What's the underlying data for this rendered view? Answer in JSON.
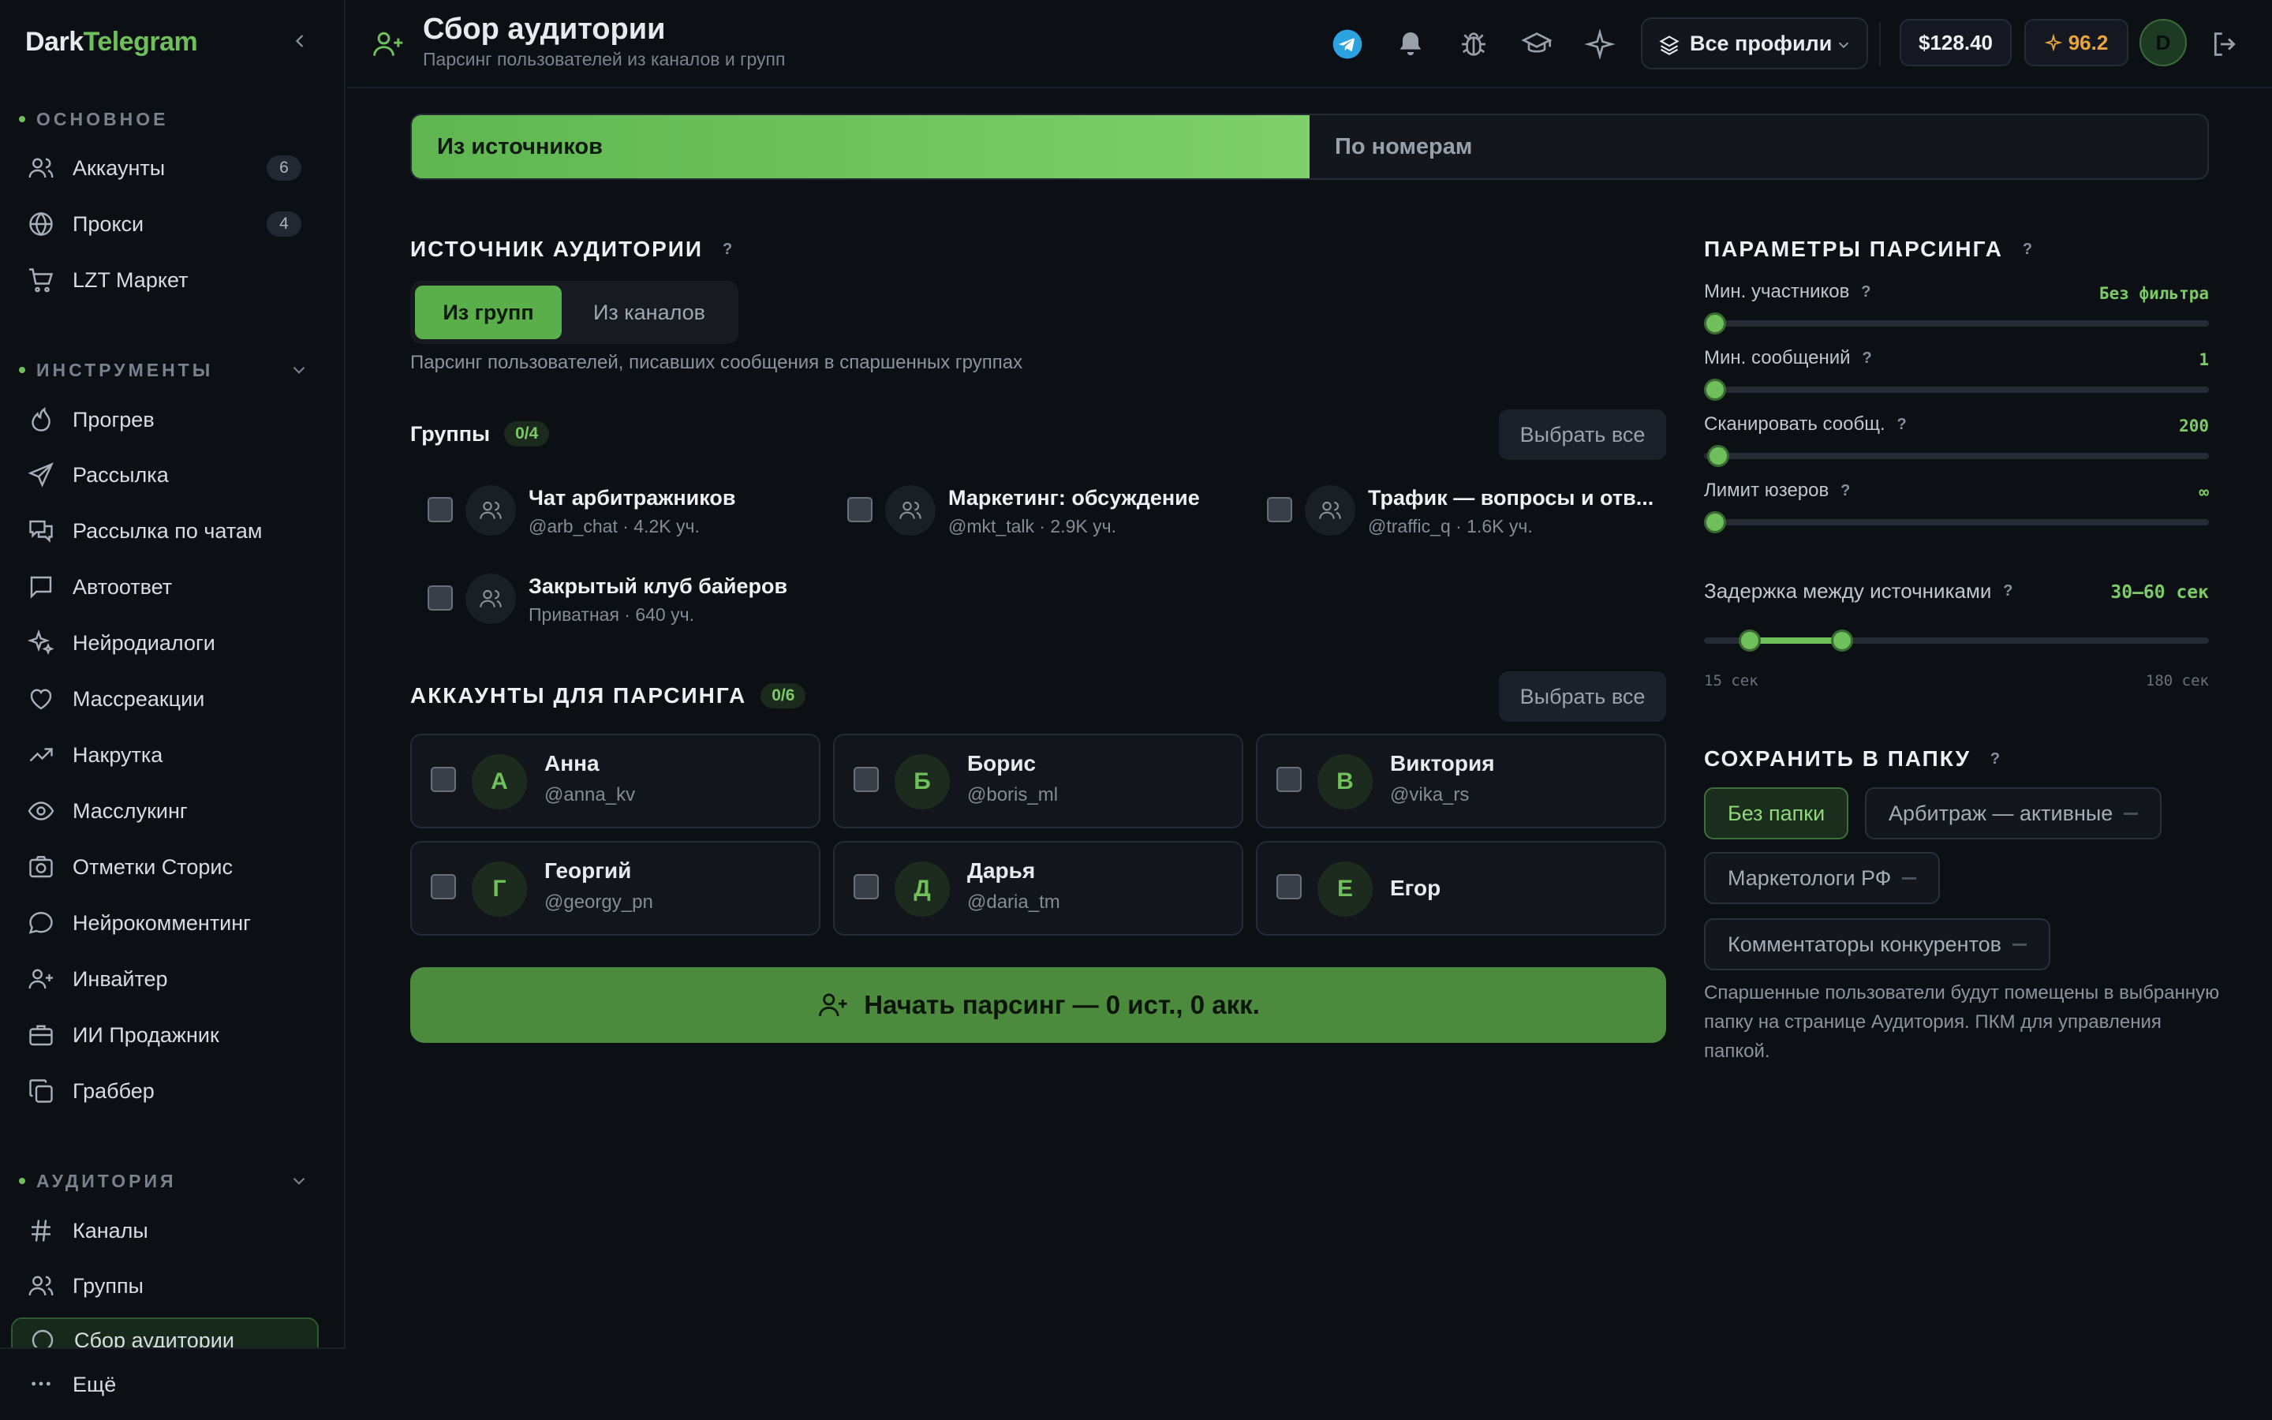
{
  "app": {
    "logo_dark": "Dark",
    "logo_green": "Telegram"
  },
  "sidebar": {
    "sections": {
      "main": "ОСНОВНОЕ",
      "tools": "ИНСТРУМЕНТЫ",
      "audience": "АУДИТОРИЯ"
    },
    "main_items": [
      {
        "label": "Аккаунты",
        "count": "6",
        "icon": "users-icon"
      },
      {
        "label": "Прокси",
        "count": "4",
        "icon": "globe-icon"
      },
      {
        "label": "LZT Маркет",
        "icon": "cart-icon"
      }
    ],
    "tool_items": [
      {
        "label": "Прогрев",
        "icon": "flame-icon"
      },
      {
        "label": "Рассылка",
        "icon": "send-icon"
      },
      {
        "label": "Рассылка по чатам",
        "icon": "chats-icon"
      },
      {
        "label": "Автоответ",
        "icon": "message-icon"
      },
      {
        "label": "Нейродиалоги",
        "icon": "sparkles-icon"
      },
      {
        "label": "Массреакции",
        "icon": "heart-icon"
      },
      {
        "label": "Накрутка",
        "icon": "trend-icon"
      },
      {
        "label": "Масслукинг",
        "icon": "eye-icon"
      },
      {
        "label": "Отметки Сторис",
        "icon": "camera-icon"
      },
      {
        "label": "Нейрокомментинг",
        "icon": "comment-icon"
      },
      {
        "label": "Инвайтер",
        "icon": "user-plus-icon"
      },
      {
        "label": "ИИ Продажник",
        "icon": "briefcase-icon"
      },
      {
        "label": "Граббер",
        "icon": "copy-icon"
      }
    ],
    "audience_items": [
      {
        "label": "Каналы",
        "icon": "hash-icon"
      },
      {
        "label": "Группы",
        "icon": "users-icon"
      },
      {
        "label": "Сбор аудитории",
        "icon": "circle-icon"
      }
    ],
    "more": "Ещё"
  },
  "header": {
    "title": "Сбор аудитории",
    "subtitle": "Парсинг пользователей из каналов и групп",
    "profiles": "Все профили",
    "balance": "$128.40",
    "points": "96.2",
    "avatar": "D"
  },
  "modes": {
    "sources": "Из источников",
    "numbers": "По номерам"
  },
  "source": {
    "heading": "ИСТОЧНИК АУДИТОРИИ",
    "from_groups": "Из групп",
    "from_channels": "Из каналов",
    "description": "Парсинг пользователей, писавших сообщения в спаршенных группах"
  },
  "groups": {
    "heading": "Группы",
    "count": "0/4",
    "select_all": "Выбрать все",
    "items": [
      {
        "name": "Чат арбитражников",
        "sub": "@arb_chat · 4.2K уч."
      },
      {
        "name": "Маркетинг: обсуждение",
        "sub": "@mkt_talk · 2.9K уч."
      },
      {
        "name": "Трафик — вопросы и отв...",
        "sub": "@traffic_q · 1.6K уч."
      },
      {
        "name": "Закрытый клуб байеров",
        "sub": "Приватная · 640 уч."
      }
    ]
  },
  "accounts": {
    "heading": "АККАУНТЫ ДЛЯ ПАРСИНГА",
    "count": "0/6",
    "select_all": "Выбрать все",
    "items": [
      {
        "initial": "А",
        "name": "Анна",
        "user": "@anna_kv"
      },
      {
        "initial": "Б",
        "name": "Борис",
        "user": "@boris_ml"
      },
      {
        "initial": "В",
        "name": "Виктория",
        "user": "@vika_rs"
      },
      {
        "initial": "Г",
        "name": "Георгий",
        "user": "@georgy_pn"
      },
      {
        "initial": "Д",
        "name": "Дарья",
        "user": "@daria_tm"
      },
      {
        "initial": "Е",
        "name": "Егор",
        "user": ""
      }
    ]
  },
  "start_button": "Начать парсинг — 0 ист., 0 акк.",
  "params": {
    "heading": "ПАРАМЕТРЫ ПАРСИНГА",
    "sliders": [
      {
        "label": "Мин. участников",
        "value": "Без фильтра",
        "level": 0
      },
      {
        "label": "Мин. сообщений",
        "value": "1",
        "level": 0
      },
      {
        "label": "Сканировать сообщ.",
        "value": "200",
        "level": 0
      },
      {
        "label": "Лимит юзеров",
        "value": "∞",
        "level": 0
      }
    ],
    "delay": {
      "label": "Задержка между источниками",
      "value": "30–60 сек",
      "min": 15,
      "max": 180,
      "from": 30,
      "to": 60,
      "min_label": "15 сек",
      "max_label": "180 сек"
    }
  },
  "folder": {
    "heading": "СОХРАНИТЬ В ПАПКУ",
    "chips": [
      "Без папки",
      "Арбитраж — активные",
      "Маркетологи РФ",
      "Комментаторы конкурентов"
    ],
    "note": "Спаршенные пользователи будут помещены в выбранную папку на странице Аудитория. ПКМ для управления папкой."
  },
  "colors": {
    "accent": "#6fbf5a",
    "bg": "#0c0f14"
  }
}
